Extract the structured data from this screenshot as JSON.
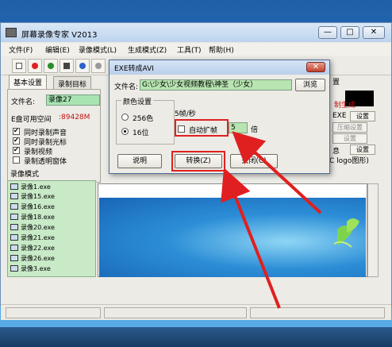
{
  "main_window": {
    "title": "屏幕录像专家 V2013",
    "min": "—",
    "max": "□",
    "close": "✕"
  },
  "menu": [
    "文件(F)",
    "编辑(E)",
    "录像模式(L)",
    "生成模式(Z)",
    "工具(T)",
    "帮助(H)"
  ],
  "tabs": [
    "基本设置",
    "录制目标"
  ],
  "left_panel": {
    "file_label": "文件名:",
    "file_value": "录像27",
    "disk_label": "E盘可用空间",
    "disk_value": ":89428M",
    "options": [
      {
        "label": "同时录制声音",
        "checked": true
      },
      {
        "label": "同时录制光标",
        "checked": true
      },
      {
        "label": "录制视频",
        "checked": true
      },
      {
        "label": "录制透明窗体",
        "checked": false
      }
    ]
  },
  "list": {
    "header": "录像模式",
    "items": [
      "录像1.exe",
      "录像15.exe",
      "录像16.exe",
      "录像18.exe",
      "录像20.exe",
      "录像21.exe",
      "录像22.exe",
      "录像26.exe",
      "录像3.exe"
    ]
  },
  "right_panel": {
    "red_label": "制生成",
    "btn1_prefix": "EXE",
    "btn1": "设置",
    "btn2": "压缩设置",
    "btn3": "设置",
    "btn4_prefix": "息",
    "btn4": "设置",
    "logo_text": "C logo图形)",
    "tab_fragment": "置"
  },
  "dialog": {
    "title": "EXE转成AVI",
    "close": "✕",
    "file_label": "文件名:",
    "file_value": "G:\\少女\\少女视频教程\\神圣（少女）",
    "browse": "浏览",
    "color_group": "颜色设置",
    "color_options": [
      {
        "label": "256色",
        "selected": false
      },
      {
        "label": "16位",
        "selected": true
      }
    ],
    "fps_label": "5帧/秒",
    "auto_label": "自动扩帧",
    "auto_checked": false,
    "mult_value": "5",
    "mult_unit": "倍",
    "help_btn": "说明",
    "convert_btn": "转换(Z)",
    "close_btn": "关闭(C)"
  },
  "colors": {
    "highlight": "#e02020",
    "list_bg": "#c8eac7",
    "input_bg": "#b8e4b1"
  }
}
